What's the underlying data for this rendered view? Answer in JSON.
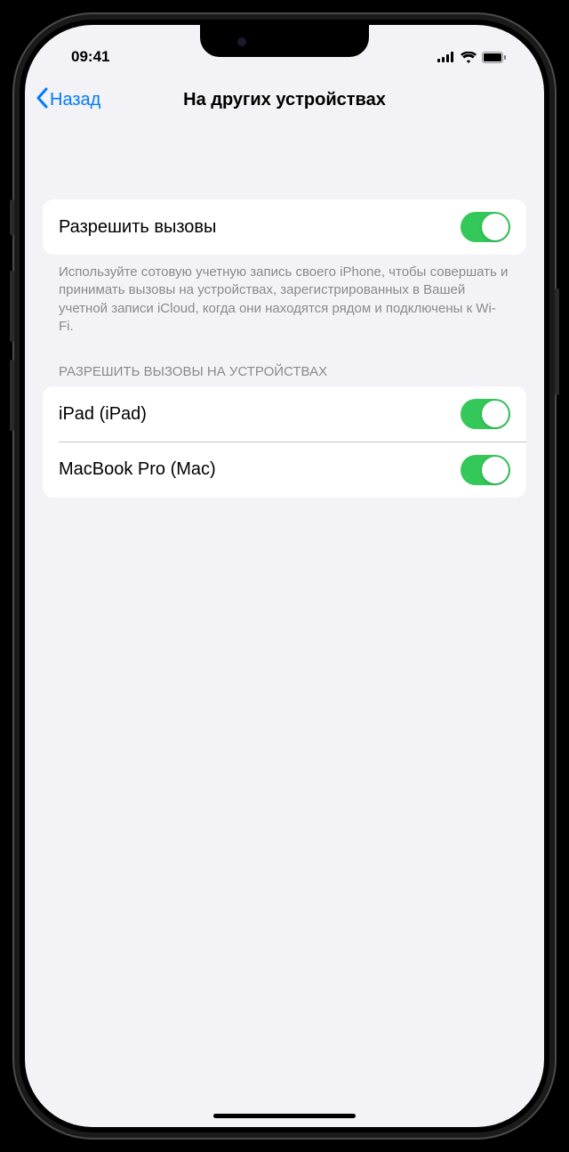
{
  "status": {
    "time": "09:41"
  },
  "nav": {
    "back_label": "Назад",
    "title": "На других устройствах"
  },
  "main_toggle": {
    "label": "Разрешить вызовы",
    "on": true
  },
  "footer_text": "Используйте сотовую учетную запись своего iPhone, чтобы совершать и принимать вызовы на устройствах, зарегистрированных в Вашей учетной записи iCloud, когда они находятся рядом и подключены к Wi-Fi.",
  "devices_header": "РАЗРЕШИТЬ ВЫЗОВЫ НА УСТРОЙСТВАХ",
  "devices": [
    {
      "label": "iPad (iPad)",
      "on": true
    },
    {
      "label": "MacBook Pro (Mac)",
      "on": true
    }
  ],
  "colors": {
    "accent": "#007aff",
    "toggle_on": "#34c759",
    "background": "#f2f2f7"
  }
}
